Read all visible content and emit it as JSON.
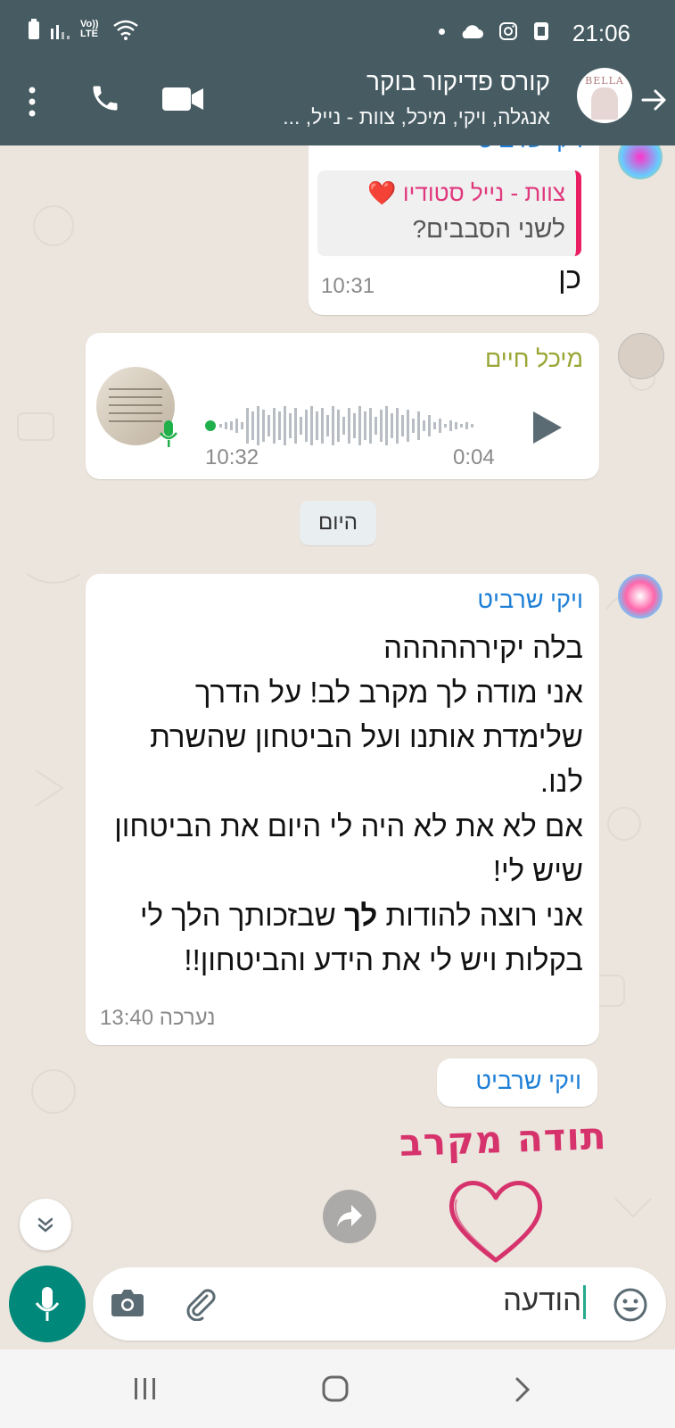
{
  "status_bar": {
    "time": "21:06",
    "network_label": "Vo)) LTE"
  },
  "header": {
    "title": "קורס פדיקור בוקר",
    "subtitle": "אנגלה, ויקי, מיכל, צוות - נייל, ...",
    "avatar_text": "BELLA"
  },
  "messages": {
    "m1": {
      "sender_partial": "ויקי שרביט",
      "quote_name": "צוות - נייל סטודיו ❤️",
      "quote_text": "לשני הסבבים?",
      "text": "כן",
      "time": "10:31"
    },
    "m2": {
      "sender": "מיכל חיים",
      "duration": "0:04",
      "time": "10:32"
    },
    "day_chip": "היום",
    "m3": {
      "sender": "ויקי שרביט",
      "text_part1": "בלה יקירההההה\nאני מודה לך מקרב לב! על הדרך שלימדת אותנו ועל הביטחון שהשרת לנו.\nאם לא את לא היה לי היום את הביטחון שיש לי!\nאני רוצה להודות ",
      "text_bold": "לך",
      "text_part2": " שבזכותך הלך לי בקלות ויש לי את הידע והביטחון!!",
      "edited": "נערכה",
      "time": "13:40"
    },
    "m4": {
      "sender": "ויקי שרביט",
      "sticker_text": "תודה מקרב"
    }
  },
  "input": {
    "typed": "הודעה"
  },
  "colors": {
    "header_bg": "#465b62",
    "chat_bg": "#ece5dd",
    "sender_blue": "#1e7fd6",
    "sender_olive": "#9aa636",
    "quote_pink": "#e0387d",
    "accent_green": "#00897b",
    "sticker_pink": "#d6336c"
  },
  "icons": [
    "back-arrow-icon",
    "video-icon",
    "phone-icon",
    "menu-icon",
    "play-icon",
    "mic-icon",
    "forward-icon",
    "chevron-down-icon",
    "emoji-icon",
    "attach-icon",
    "camera-icon"
  ]
}
